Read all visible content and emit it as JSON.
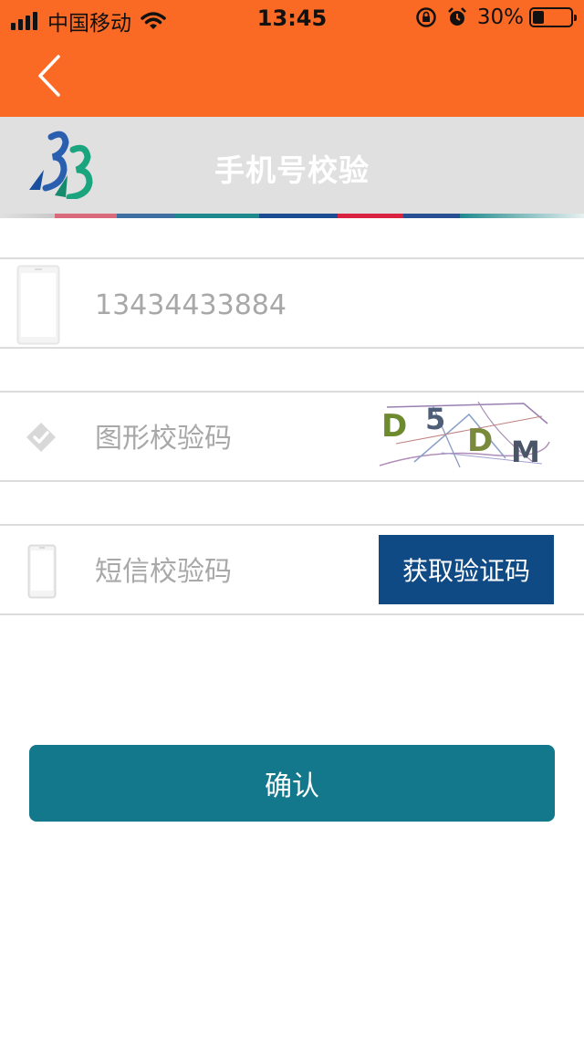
{
  "status_bar": {
    "carrier": "中国移动",
    "time": "13:45",
    "battery": "30%",
    "battery_level": 0.3
  },
  "nav": {
    "back_icon": "chevron-left-icon"
  },
  "header": {
    "title": "手机号校验",
    "logo": "logo-icon"
  },
  "form": {
    "phone": {
      "value": "13434433884",
      "icon": "phone-icon"
    },
    "image_code": {
      "placeholder": "图形校验码",
      "icon": "check-icon",
      "captcha_text": "D5DM"
    },
    "sms_code": {
      "placeholder": "短信校验码",
      "icon": "phone-icon",
      "button_label": "获取验证码"
    }
  },
  "confirm_label": "确认",
  "colors": {
    "nav_bg": "#fa6a25",
    "header_bg": "#e0e0e0",
    "sms_button": "#104a85",
    "confirm_button": "#13788b"
  }
}
